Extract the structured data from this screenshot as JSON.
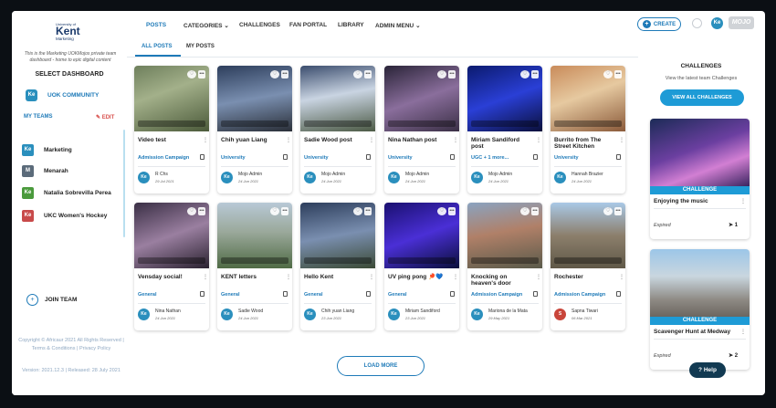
{
  "sidebar": {
    "logo": {
      "line1": "University of",
      "line2": "Kent",
      "line3": "Marketing"
    },
    "tagline": "This is the Marketing UOKMojos private team dashboard - home to epic digital content",
    "select_dashboard": "SELECT DASHBOARD",
    "community": {
      "badge": "Ke",
      "label": "UOK COMMUNITY"
    },
    "my_teams_label": "MY TEAMS",
    "edit_label": "EDIT",
    "teams": [
      {
        "badge": "Ke",
        "label": "Marketing",
        "color": "#2a8fbd"
      },
      {
        "badge": "M",
        "label": "Menarah",
        "color": "#5b6b7a"
      },
      {
        "badge": "Ke",
        "label": "Natalia Sobrevilla Perea",
        "color": "#4a9a3c"
      },
      {
        "badge": "Ke",
        "label": "UKC Women's Hockey",
        "color": "#c84a4a"
      }
    ],
    "join_team": "JOIN TEAM",
    "copyright": "Copyright © Africaur 2021 All Rights Reserved | Terms & Conditions | Privacy Policy",
    "version": "Version: 2021.12.3 | Released: 28 July 2021"
  },
  "nav": {
    "posts": "POSTS",
    "categories": "CATEGORIES",
    "challenges": "CHALLENGES",
    "fan_portal": "FAN PORTAL",
    "library": "LIBRARY",
    "admin_menu": "ADMIN MENU"
  },
  "subtabs": {
    "all_posts": "ALL POSTS",
    "my_posts": "MY POSTS"
  },
  "header": {
    "create": "CREATE",
    "top_badge": "Ke",
    "brand": "MOJO"
  },
  "posts": [
    {
      "title": "Video test",
      "campaign": "Admission Campaign",
      "author": "R Chs",
      "date": "29 Jul 2021",
      "av": "Ke"
    },
    {
      "title": "Chih yuan Liang",
      "campaign": "University",
      "author": "Mojo Admin",
      "date": "24 Jun 2021",
      "av": "Ke"
    },
    {
      "title": "Sadie Wood post",
      "campaign": "University",
      "author": "Mojo Admin",
      "date": "24 Jun 2021",
      "av": "Ke"
    },
    {
      "title": "Nina Nathan post",
      "campaign": "University",
      "author": "Mojo Admin",
      "date": "24 Jun 2021",
      "av": "Ke"
    },
    {
      "title": "Miriam Sandiford post",
      "campaign": "UGC + 1 more...",
      "author": "Mojo Admin",
      "date": "24 Jun 2021",
      "av": "Ke"
    },
    {
      "title": "Burrito from The Street Kitchen",
      "campaign": "University",
      "author": "Hannah Brazier",
      "date": "24 Jun 2021",
      "av": "Ke"
    },
    {
      "title": "Vensday social!",
      "campaign": "General",
      "author": "Nina Nathan",
      "date": "24 Jun 2021",
      "av": "Ke"
    },
    {
      "title": "KENT letters",
      "campaign": "General",
      "author": "Sadie Wood",
      "date": "24 Jun 2021",
      "av": "Ke"
    },
    {
      "title": "Hello Kent",
      "campaign": "General",
      "author": "Chih yuan Liang",
      "date": "23 Jun 2021",
      "av": "Ke"
    },
    {
      "title": "UV ping pong 🏓💙",
      "campaign": "General",
      "author": "Miriam Sandiford",
      "date": "23 Jun 2021",
      "av": "Ke"
    },
    {
      "title": "Knocking on heaven's door",
      "campaign": "Admission Campaign",
      "author": "Mariona de la Mata",
      "date": "29 May 2021",
      "av": "Ke"
    },
    {
      "title": "Rochester",
      "campaign": "Admission Campaign",
      "author": "Sapna Tiwari",
      "date": "06 Mar 2021",
      "av": "S"
    }
  ],
  "load_more": "LOAD MORE",
  "challenges": {
    "title": "CHALLENGES",
    "subtitle": "View the latest team Challenges",
    "button": "VIEW ALL CHALLENGES",
    "cards": [
      {
        "ribbon": "CHALLENGE",
        "title": "Enjoying the music",
        "status": "Expired",
        "count": "1"
      },
      {
        "ribbon": "CHALLENGE",
        "title": "Scavenger Hunt at Medway",
        "status": "Expired",
        "count": "2"
      }
    ]
  },
  "help": "Help"
}
